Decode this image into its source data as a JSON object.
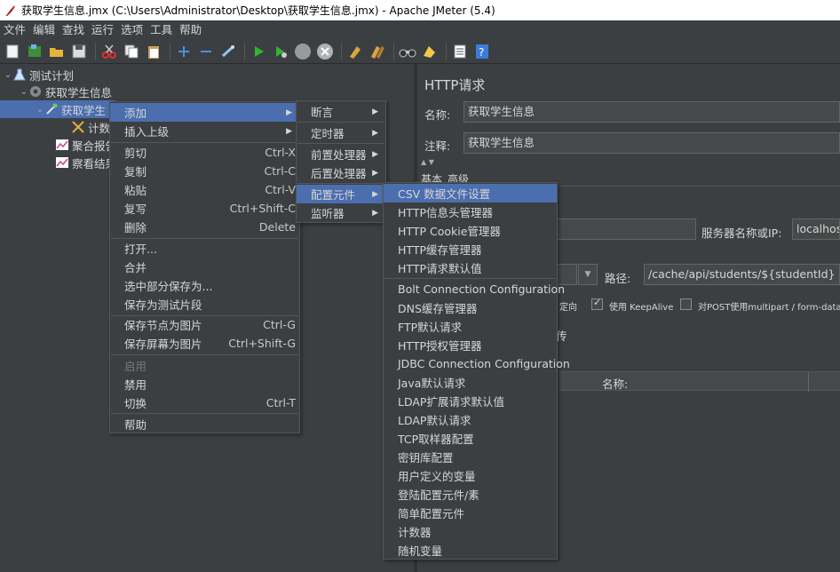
{
  "window": {
    "title": "获取学生信息.jmx (C:\\Users\\Administrator\\Desktop\\获取学生信息.jmx) - Apache JMeter (5.4)"
  },
  "menubar": [
    "文件",
    "编辑",
    "查找",
    "运行",
    "选项",
    "工具",
    "帮助"
  ],
  "tree": {
    "nodes": [
      {
        "label": "测试计划"
      },
      {
        "label": "获取学生信息"
      },
      {
        "label": "获取学生"
      },
      {
        "label": "计数"
      },
      {
        "label": "聚合报告"
      },
      {
        "label": "察看结果"
      }
    ]
  },
  "right_panel": {
    "title": "HTTP请求",
    "name_label": "名称:",
    "name_value": "获取学生信息",
    "comment_label": "注释:",
    "comment_value": "获取学生信息",
    "tab_basic": "基本",
    "tab_advanced": "高级",
    "server_label": "服务器名称或IP:",
    "server_value": "localhost",
    "path_label": "路径:",
    "path_value": "/cache/api/students/${studentId}",
    "redirect_partial": "定向",
    "keepalive_label": "使用 KeepAlive",
    "multipart_label": "对POST使用multipart / form-data",
    "pass_partial": "传",
    "table_name_header": "名称:"
  },
  "context_menu": {
    "items": [
      {
        "label": "添加",
        "accel": ""
      },
      {
        "label": "插入上级",
        "accel": ""
      },
      {
        "label": "剪切",
        "accel": "Ctrl-X"
      },
      {
        "label": "复制",
        "accel": "Ctrl-C"
      },
      {
        "label": "粘贴",
        "accel": "Ctrl-V"
      },
      {
        "label": "复写",
        "accel": "Ctrl+Shift-C"
      },
      {
        "label": "删除",
        "accel": "Delete"
      },
      {
        "label": "打开...",
        "accel": ""
      },
      {
        "label": "合并",
        "accel": ""
      },
      {
        "label": "选中部分保存为...",
        "accel": ""
      },
      {
        "label": "保存为测试片段",
        "accel": ""
      },
      {
        "label": "保存节点为图片",
        "accel": "Ctrl-G"
      },
      {
        "label": "保存屏幕为图片",
        "accel": "Ctrl+Shift-G"
      },
      {
        "label": "启用",
        "accel": ""
      },
      {
        "label": "禁用",
        "accel": ""
      },
      {
        "label": "切换",
        "accel": "Ctrl-T"
      },
      {
        "label": "帮助",
        "accel": ""
      }
    ]
  },
  "add_submenu": {
    "items": [
      {
        "label": "断言"
      },
      {
        "label": "定时器"
      },
      {
        "label": "前置处理器"
      },
      {
        "label": "后置处理器"
      },
      {
        "label": "配置元件"
      },
      {
        "label": "监听器"
      }
    ]
  },
  "config_submenu": {
    "items": [
      {
        "label": "CSV 数据文件设置"
      },
      {
        "label": "HTTP信息头管理器"
      },
      {
        "label": "HTTP Cookie管理器"
      },
      {
        "label": "HTTP缓存管理器"
      },
      {
        "label": "HTTP请求默认值"
      },
      {
        "label": "Bolt Connection Configuration"
      },
      {
        "label": "DNS缓存管理器"
      },
      {
        "label": "FTP默认请求"
      },
      {
        "label": "HTTP授权管理器"
      },
      {
        "label": "JDBC Connection Configuration"
      },
      {
        "label": "Java默认请求"
      },
      {
        "label": "LDAP扩展请求默认值"
      },
      {
        "label": "LDAP默认请求"
      },
      {
        "label": "TCP取样器配置"
      },
      {
        "label": "密钥库配置"
      },
      {
        "label": "用户定义的变量"
      },
      {
        "label": "登陆配置元件/素"
      },
      {
        "label": "简单配置元件"
      },
      {
        "label": "计数器"
      },
      {
        "label": "随机变量"
      }
    ]
  },
  "colors": {
    "background": "#3c3f41",
    "highlight": "#4b6eaf",
    "text": "#d6d6d6"
  }
}
